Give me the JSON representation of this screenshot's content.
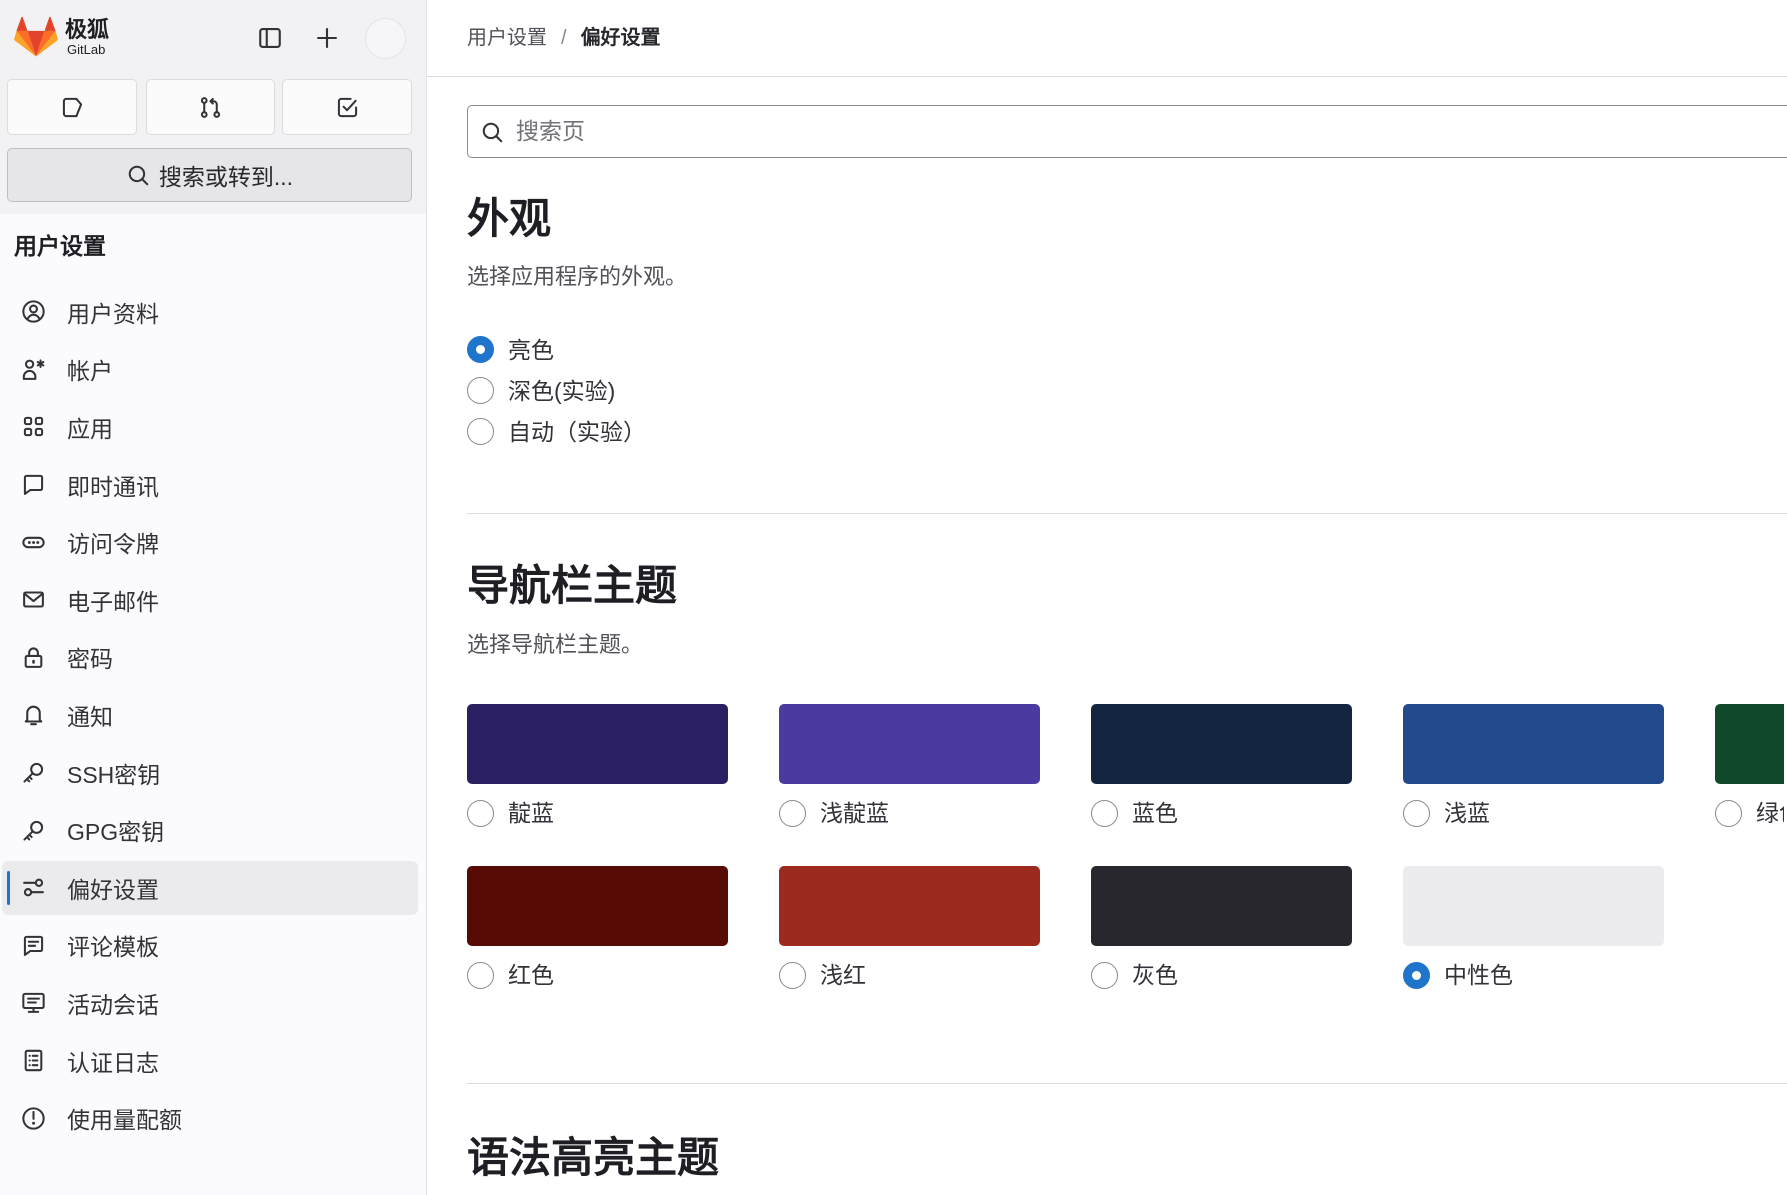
{
  "app": {
    "brand_cn": "极狐",
    "brand_en": "GitLab"
  },
  "sidebar": {
    "top_icons": [
      "sidebar-panel-icon",
      "plus-icon"
    ],
    "quick_actions": [
      {
        "icon": "issues-icon"
      },
      {
        "icon": "merge-request-icon"
      },
      {
        "icon": "todo-icon"
      }
    ],
    "search_label": "搜索或转到...",
    "section_title": "用户设置",
    "active_index": 10,
    "items": [
      {
        "label": "用户资料",
        "icon": "user-circle-icon"
      },
      {
        "label": "帐户",
        "icon": "account-icon"
      },
      {
        "label": "应用",
        "icon": "applications-icon"
      },
      {
        "label": "即时通讯",
        "icon": "chat-icon"
      },
      {
        "label": "访问令牌",
        "icon": "token-icon"
      },
      {
        "label": "电子邮件",
        "icon": "mail-icon"
      },
      {
        "label": "密码",
        "icon": "lock-icon"
      },
      {
        "label": "通知",
        "icon": "bell-icon"
      },
      {
        "label": "SSH密钥",
        "icon": "key-icon"
      },
      {
        "label": "GPG密钥",
        "icon": "key-icon"
      },
      {
        "label": "偏好设置",
        "icon": "preferences-icon"
      },
      {
        "label": "评论模板",
        "icon": "comment-template-icon"
      },
      {
        "label": "活动会话",
        "icon": "monitor-icon"
      },
      {
        "label": "认证日志",
        "icon": "log-icon"
      },
      {
        "label": "使用量配额",
        "icon": "quota-icon"
      }
    ]
  },
  "breadcrumb": {
    "parent": "用户设置",
    "separator": "/",
    "current": "偏好设置"
  },
  "search": {
    "placeholder": "搜索页"
  },
  "appearance": {
    "title": "外观",
    "description": "选择应用程序的外观。",
    "options": [
      {
        "label": "亮色",
        "checked": true
      },
      {
        "label": "深色(实验)",
        "checked": false
      },
      {
        "label": "自动（实验）",
        "checked": false
      }
    ]
  },
  "nav_theme": {
    "title": "导航栏主题",
    "description": "选择导航栏主题。",
    "themes": [
      {
        "label": "靛蓝",
        "color": "#2a1f61",
        "checked": false
      },
      {
        "label": "浅靛蓝",
        "color": "#4b3aa0",
        "checked": false
      },
      {
        "label": "蓝色",
        "color": "#13243f",
        "checked": false
      },
      {
        "label": "浅蓝",
        "color": "#244a8e",
        "checked": false
      },
      {
        "label": "绿色",
        "color": "#104a2b",
        "checked": false
      },
      {
        "label": "红色",
        "color": "#560c04",
        "checked": false
      },
      {
        "label": "浅红",
        "color": "#9c2a1f",
        "checked": false
      },
      {
        "label": "灰色",
        "color": "#28272d",
        "checked": false
      },
      {
        "label": "中性色",
        "color": "#ececef",
        "checked": true
      }
    ]
  },
  "syntax_theme": {
    "title": "语法高亮主题"
  },
  "colors": {
    "accent": "#1f75cb",
    "logo_orange": "#fc6d26",
    "logo_red": "#e24329",
    "logo_yellow": "#fca326"
  }
}
